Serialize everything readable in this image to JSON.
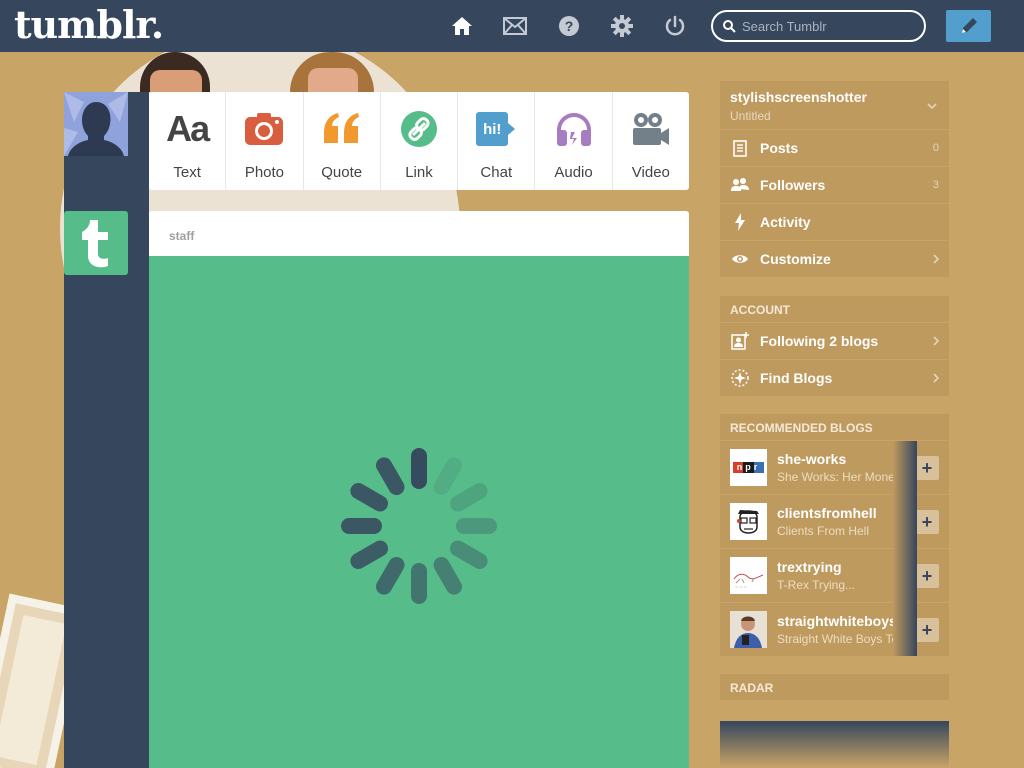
{
  "brand": {
    "logo_text": "tumblr."
  },
  "nav": {
    "icons": [
      "home-icon",
      "mail-icon",
      "help-icon",
      "gear-icon",
      "power-icon"
    ],
    "search_placeholder": "Search Tumblr",
    "compose_icon": "pencil-icon"
  },
  "post_types": [
    {
      "label": "Text",
      "icon": "text-icon",
      "glyph": "Aa",
      "color": "#444444"
    },
    {
      "label": "Photo",
      "icon": "camera-icon",
      "color": "#d95e40"
    },
    {
      "label": "Quote",
      "icon": "quote-icon",
      "glyph": "““",
      "color": "#f2992e"
    },
    {
      "label": "Link",
      "icon": "link-icon",
      "color": "#56bc8a"
    },
    {
      "label": "Chat",
      "icon": "chat-icon",
      "glyph": "hi!",
      "color": "#529ecc"
    },
    {
      "label": "Audio",
      "icon": "headphones-icon",
      "color": "#a77dc2"
    },
    {
      "label": "Video",
      "icon": "video-camera-icon",
      "color": "#748089"
    }
  ],
  "post": {
    "author": "staff",
    "body_color": "#56bc8a"
  },
  "sidebar": {
    "blog": {
      "name": "stylishscreenshotter",
      "subtitle": "Untitled"
    },
    "blog_items": [
      {
        "label": "Posts",
        "icon": "posts-icon",
        "count": "0"
      },
      {
        "label": "Followers",
        "icon": "followers-icon",
        "count": "3"
      },
      {
        "label": "Activity",
        "icon": "lightning-icon"
      },
      {
        "label": "Customize",
        "icon": "eye-icon"
      }
    ],
    "account": {
      "heading": "ACCOUNT",
      "items": [
        {
          "label": "Following 2 blogs",
          "icon": "following-icon"
        },
        {
          "label": "Find Blogs",
          "icon": "compass-icon"
        }
      ]
    },
    "recommended": {
      "heading": "RECOMMENDED BLOGS",
      "blogs": [
        {
          "name": "she-works",
          "desc": "She Works: Her Money",
          "avatar_text": "npr"
        },
        {
          "name": "clientsfromhell",
          "desc": "Clients From Hell"
        },
        {
          "name": "trextrying",
          "desc": "T-Rex Trying..."
        },
        {
          "name": "straightwhiteboys",
          "desc": "Straight White Boys Texting"
        }
      ]
    },
    "radar": {
      "heading": "RADAR"
    }
  },
  "colors": {
    "topbar": "#36465d",
    "background": "#c9a467",
    "accent": "#529ecc",
    "staff_green": "#56bc8a"
  }
}
